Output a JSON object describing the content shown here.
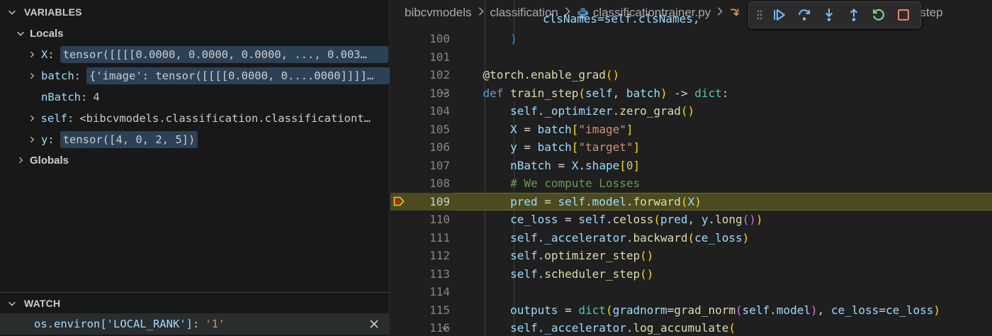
{
  "variables": {
    "title": "VARIABLES",
    "locals_label": "Locals",
    "globals_label": "Globals",
    "items": [
      {
        "name": "X",
        "value": "tensor([[[[0.0000, 0.0000, 0.0000,  ..., 0.003…"
      },
      {
        "name": "batch",
        "value": "{'image': tensor([[[[0.0000, 0....0000]]]]…"
      },
      {
        "name": "nBatch",
        "value": "4"
      },
      {
        "name": "self",
        "value": "<bibcvmodels.classification.classificationt…"
      },
      {
        "name": "y",
        "value": "tensor([4, 0, 2, 5])"
      }
    ]
  },
  "watch": {
    "title": "WATCH",
    "expression": "os.environ['LOCAL_RANK']",
    "value": "'1'"
  },
  "breadcrumb": {
    "items": [
      "bibcvmodels",
      "classification",
      "classificationtrainer.py"
    ],
    "symbol_tail": "_step"
  },
  "debug_toolbar": {
    "buttons": [
      "grip-icon",
      "continue-icon",
      "step-over-icon",
      "step-into-icon",
      "step-out-icon",
      "restart-icon",
      "stop-icon"
    ]
  },
  "editor": {
    "current_line": "109",
    "line_numbers": [
      "100",
      "101",
      "102",
      "103",
      "104",
      "105",
      "106",
      "107",
      "108",
      "109",
      "110",
      "111",
      "112",
      "113",
      "114",
      "115",
      "116"
    ],
    "partial_top_line": "clsNames=self.clsNames,"
  },
  "colors": {
    "keyword": "#569cd6",
    "function": "#dcdcaa",
    "variable": "#9cdcfe",
    "string": "#ce9178",
    "comment": "#6a9955",
    "number": "#b5cea8",
    "current_line_bg": "#4b4b1f",
    "toolbar_blue": "#75beff",
    "toolbar_green": "#89d185",
    "toolbar_red": "#f48771"
  }
}
